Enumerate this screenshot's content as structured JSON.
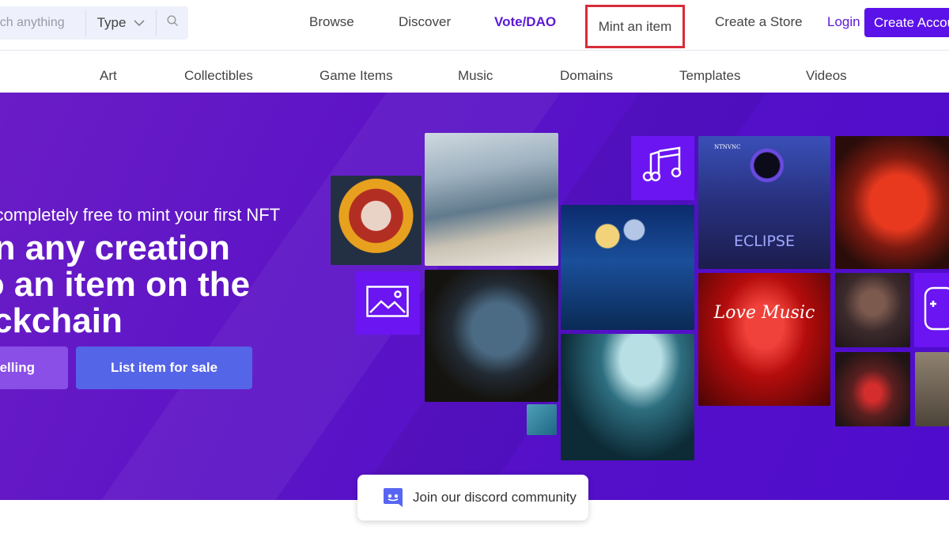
{
  "search": {
    "placeholder": "Search anything",
    "type_label": "Type"
  },
  "nav": {
    "browse": "Browse",
    "discover": "Discover",
    "vote": "Vote/DAO",
    "mint": "Mint an item",
    "create_store": "Create a Store",
    "login": "Login",
    "create_account": "Create Account"
  },
  "categories": [
    "Art",
    "Collectibles",
    "Game Items",
    "Music",
    "Domains",
    "Templates",
    "Videos"
  ],
  "hero": {
    "subtitle": "It's completely free to mint your first NFT",
    "title": "Turn any creation\ninto an item on the\nblockchain",
    "start_button": "Start selling",
    "list_button": "List item for sale"
  },
  "gallery": {
    "eclipse_label": "ECLIPSE",
    "love_music_label": "Love Music",
    "ntnvnc_label": "NTNVNC"
  },
  "discord": {
    "label": "Join our discord community"
  },
  "colors": {
    "brand": "#5b12e8",
    "hero_bg": "#5d14c6",
    "highlight_box": "#d92b3a",
    "list_button": "#5565e8",
    "start_button": "#8a4fe6"
  }
}
